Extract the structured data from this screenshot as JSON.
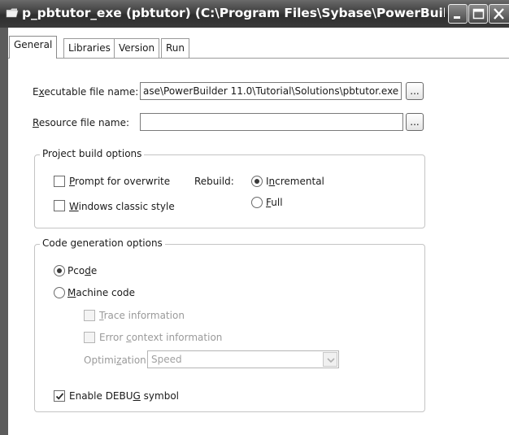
{
  "window": {
    "title": "p_pbtutor_exe (pbtutor) (C:\\Program Files\\Sybase\\PowerBuilder ...",
    "title_icon": "folder-icon",
    "minimize_icon": "minimize-icon",
    "maximize_icon": "maximize-icon",
    "close_icon": "close-icon"
  },
  "tabs": [
    {
      "label": "General",
      "active": true
    },
    {
      "label": "Libraries",
      "active": false
    },
    {
      "label": "Version",
      "active": false
    },
    {
      "label": "Run",
      "active": false
    }
  ],
  "general": {
    "executable": {
      "label_pre": "E",
      "label_accel": "x",
      "label_post": "ecutable file name:",
      "value": "ase\\PowerBuilder 11.0\\Tutorial\\Solutions\\pbtutor.exe",
      "browse_label": "..."
    },
    "resource": {
      "label_accel": "R",
      "label_post": "esource file name:",
      "value": "",
      "browse_label": "..."
    },
    "project_build": {
      "title": "Project build options",
      "prompt_overwrite": {
        "accel": "P",
        "rest": "rompt for overwrite",
        "checked": false
      },
      "windows_classic": {
        "accel": "W",
        "rest": "indows classic style",
        "checked": false
      },
      "rebuild_label": "Rebuild:",
      "incremental": {
        "pre": "I",
        "accel": "n",
        "rest": "cremental",
        "selected": true
      },
      "full": {
        "accel": "F",
        "rest": "ull",
        "selected": false
      }
    },
    "code_generation": {
      "title": "Code generation options",
      "pcode": {
        "pre": "Pco",
        "accel": "d",
        "rest": "e",
        "selected": true
      },
      "machine_code": {
        "accel": "M",
        "rest": "achine code",
        "selected": false
      },
      "trace": {
        "accel": "T",
        "rest": "race information",
        "checked": false,
        "enabled": false
      },
      "error_context": {
        "pre": "Error ",
        "accel": "c",
        "rest": "ontext information",
        "checked": false,
        "enabled": false
      },
      "optimization": {
        "pre": "Optimi",
        "accel": "z",
        "rest": "ation:",
        "value": "Speed",
        "enabled": false
      },
      "debug": {
        "pre": "Enable DEBU",
        "accel": "G",
        "rest": " symbol",
        "checked": true
      }
    }
  }
}
